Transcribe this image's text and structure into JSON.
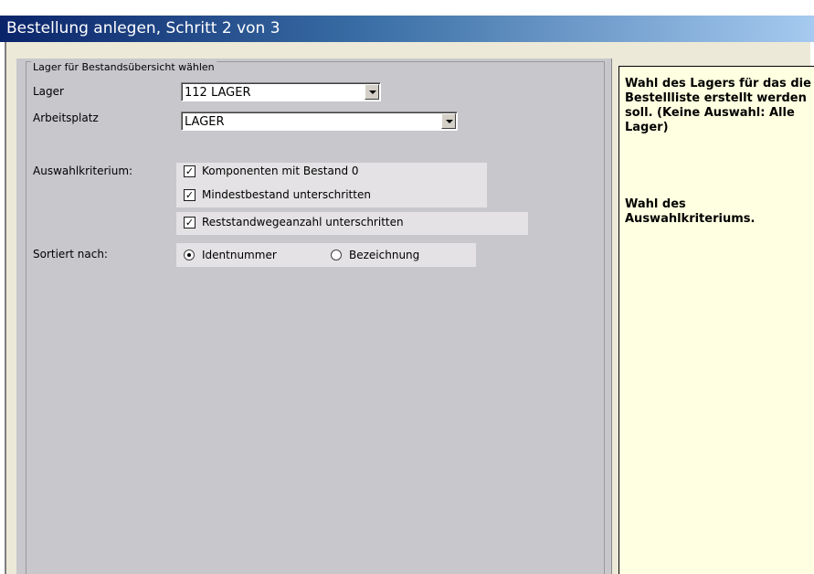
{
  "title": "Bestellung anlegen, Schritt 2 von 3",
  "group": {
    "legend": "Lager für Bestandsübersicht wählen",
    "lager": {
      "label": "Lager",
      "value": "112 LAGER"
    },
    "arbeitsplatz": {
      "label": "Arbeitsplatz",
      "value": "LAGER"
    },
    "auswahl": {
      "label": "Auswahlkriterium:",
      "options": [
        {
          "label": "Komponenten mit Bestand 0",
          "checked": true
        },
        {
          "label": "Mindestbestand unterschritten",
          "checked": true
        },
        {
          "label": "Reststandwegeanzahl unterschritten",
          "checked": true
        }
      ]
    },
    "sortierung": {
      "label": "Sortiert nach:",
      "options": [
        {
          "label": "Identnummer",
          "selected": true
        },
        {
          "label": "Bezeichnung",
          "selected": false
        }
      ]
    }
  },
  "help": {
    "paragraph1": "Wahl des Lagers für das die Bestellliste erstellt werden soll. (Keine Auswahl: Alle Lager)",
    "paragraph2": "Wahl des Auswahlkriteriums."
  },
  "colors": {
    "title_start": "#0a246a",
    "title_end": "#a6caf0",
    "help_background": "#ffffe1",
    "panel_background": "#c8c7cc"
  }
}
